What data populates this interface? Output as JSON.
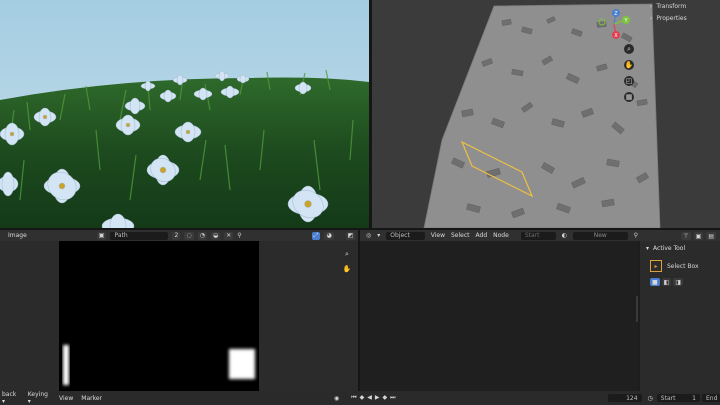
{
  "viewport_panel": {
    "transform_label": "Transform",
    "properties_label": "Properties",
    "gizmo": {
      "x": "X",
      "y": "Y",
      "z": "Z"
    }
  },
  "image_editor": {
    "image_menu": "Image",
    "image_name": "Path",
    "user_count": "2"
  },
  "node_editor": {
    "object_mode": "Object",
    "menu": [
      "View",
      "Select",
      "Add",
      "Node"
    ],
    "start_placeholder": "Start",
    "new_label": "New"
  },
  "tool_panel": {
    "title": "Active Tool",
    "tool_name": "Select Box"
  },
  "timeline": {
    "playback": "back",
    "keying": "Keying",
    "view": "View",
    "marker": "Marker",
    "current_frame": "124",
    "start_label": "Start",
    "start_value": "1",
    "end_label": "End"
  },
  "colors": {
    "sky": "#9ec6dc",
    "grass": "#1f4a20",
    "flower": "#cfe0f2",
    "accent_blue": "#4a7fd0",
    "selection": "#f0c040"
  }
}
